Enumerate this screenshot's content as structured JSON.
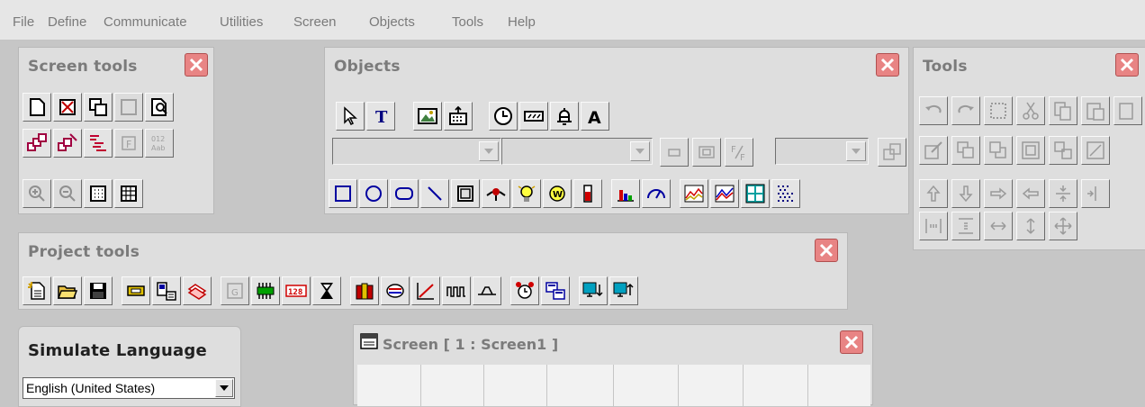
{
  "menu": [
    "File",
    "Define",
    "Communicate",
    "Utilities",
    "Screen",
    "Objects",
    "Tools",
    "Help"
  ],
  "panels": {
    "screen_tools": {
      "title": "Screen tools"
    },
    "objects": {
      "title": "Objects"
    },
    "tools": {
      "title": "Tools"
    },
    "project_tools": {
      "title": "Project tools"
    },
    "simulate_language": {
      "title": "Simulate Language",
      "selected": "English (United States)"
    },
    "screen_window": {
      "title": "Screen [ 1 : Screen1 ]"
    }
  },
  "icons": {
    "text_tool": "T",
    "font_tool": "A",
    "view_number": "012",
    "view_ab": "Aab",
    "font_label": "F",
    "fraction_label": "F/F",
    "project_group": "G",
    "project_number": "128"
  },
  "colors": {
    "close_button": "#e88484",
    "menu_text": "#7a7a7a",
    "panel_bg": "#dedede"
  }
}
